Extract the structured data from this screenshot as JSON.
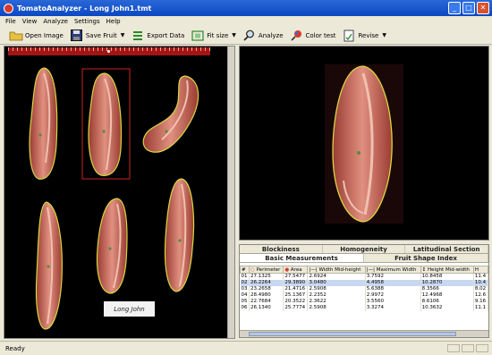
{
  "window": {
    "title": "TomatoAnalyzer - Long John1.tmt",
    "minimize": "_",
    "maximize": "□",
    "close": "✕"
  },
  "menu": [
    "File",
    "View",
    "Analyze",
    "Settings",
    "Help"
  ],
  "toolbar": {
    "open_image": "Open Image",
    "save_fruit": "Save Fruit",
    "export_data": "Export Data",
    "fit_size": "Fit size",
    "analyze": "Analyze",
    "color_test": "Color test",
    "revise": "Revise"
  },
  "sample_label": "Long John",
  "tabs": {
    "row1": [
      "Blockiness",
      "Homogeneity",
      "Latitudinal Section"
    ],
    "row2": [
      "Basic Measurements",
      "Fruit Shape Index"
    ]
  },
  "table": {
    "columns": [
      "#",
      "Perimeter",
      "Area",
      "Width Mid-height",
      "Maximum Width",
      "Height Mid-width",
      "H"
    ],
    "rows": [
      [
        "01",
        "27.1325",
        "27.5477",
        "2.6924",
        "3.7592",
        "10.8458",
        "11.4"
      ],
      [
        "02",
        "26.2264",
        "29.3890",
        "3.0480",
        "4.4958",
        "10.2870",
        "10.4"
      ],
      [
        "03",
        "23.2658",
        "21.4716",
        "2.5908",
        "5.6388",
        "8.3566",
        "8.02"
      ],
      [
        "04",
        "28.4980",
        "25.1367",
        "2.2352",
        "2.9972",
        "12.4968",
        "12.6"
      ],
      [
        "05",
        "22.7684",
        "20.3522",
        "2.3622",
        "3.5560",
        "8.6106",
        "9.16"
      ],
      [
        "06",
        "26.1340",
        "25.7774",
        "2.5908",
        "3.3274",
        "10.3632",
        "11.1"
      ]
    ],
    "selected_row": 1
  },
  "status": "Ready",
  "colors": {
    "accent": "#0b48c2",
    "fruit_flesh": "#c86a5a",
    "fruit_outline": "#d8d840",
    "selection_box": "#cc2222"
  }
}
